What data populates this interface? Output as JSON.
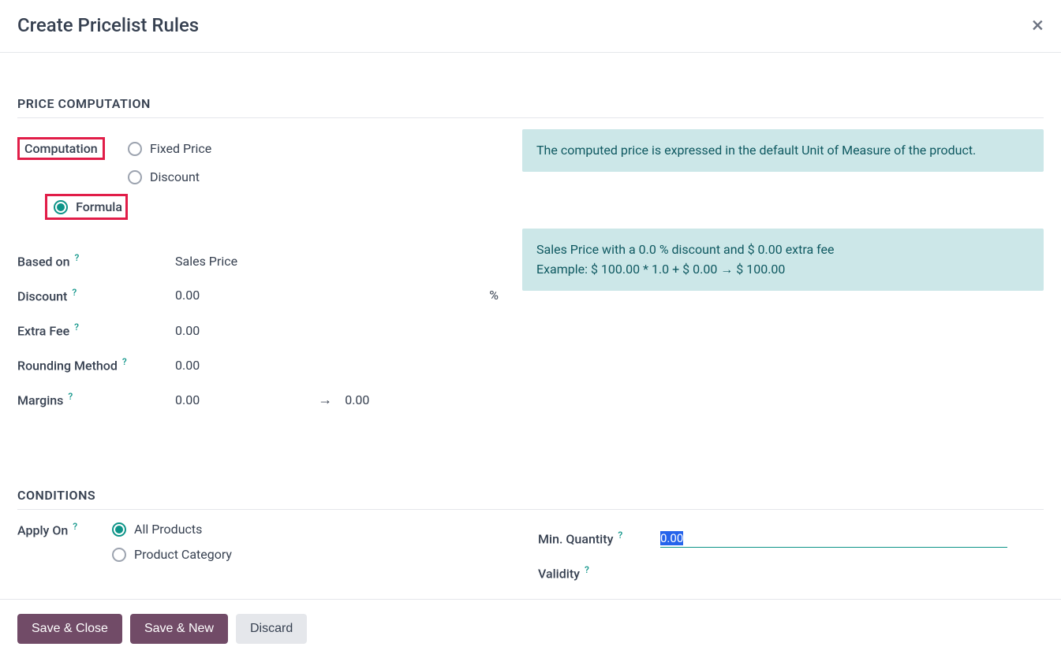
{
  "modal": {
    "title": "Create Pricelist Rules"
  },
  "sections": {
    "price_computation": "Price Computation",
    "conditions": "Conditions"
  },
  "computation": {
    "label": "Computation",
    "options": {
      "fixed": "Fixed Price",
      "discount": "Discount",
      "formula": "Formula"
    }
  },
  "info_box1": "The computed price is expressed in the default Unit of Measure of the product.",
  "fields": {
    "based_on": {
      "label": "Based on",
      "value": "Sales Price"
    },
    "discount": {
      "label": "Discount",
      "value": "0.00",
      "suffix": "%"
    },
    "extra_fee": {
      "label": "Extra Fee",
      "value": "0.00"
    },
    "rounding": {
      "label": "Rounding Method",
      "value": "0.00"
    },
    "margins": {
      "label": "Margins",
      "from": "0.00",
      "to": "0.00"
    }
  },
  "info_box2": {
    "line1": "Sales Price with a 0.0 % discount and $ 0.00 extra fee",
    "line2": "Example: $ 100.00 * 1.0 + $ 0.00 → $ 100.00"
  },
  "apply_on": {
    "label": "Apply On",
    "options": {
      "all": "All Products",
      "category": "Product Category"
    }
  },
  "min_qty": {
    "label": "Min. Quantity",
    "value": "0.00"
  },
  "validity": {
    "label": "Validity"
  },
  "footer": {
    "save_close": "Save & Close",
    "save_new": "Save & New",
    "discard": "Discard"
  },
  "help_glyph": "?"
}
